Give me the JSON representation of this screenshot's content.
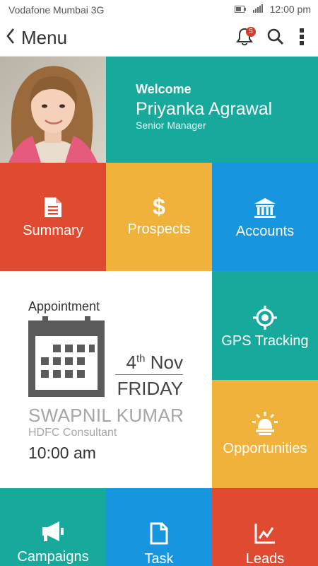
{
  "status_bar": {
    "carrier": "Vodafone Mumbai 3G",
    "time": "12:00 pm",
    "icons": [
      "battery-icon",
      "signal-icon"
    ]
  },
  "app_bar": {
    "back_icon": "chevron-left-icon",
    "title": "Menu",
    "notification_count": "5",
    "actions": [
      "bell-icon",
      "search-icon",
      "more-vertical-icon"
    ]
  },
  "profile": {
    "welcome": "Welcome",
    "name": "Priyanka Agrawal",
    "role": "Senior Manager",
    "photo": "profile-photo"
  },
  "tiles": {
    "summary": {
      "label": "Summary",
      "icon": "document-icon",
      "color": "#e04a30"
    },
    "prospects": {
      "label": "Prospects",
      "icon": "dollar-icon",
      "color": "#f0b23a"
    },
    "accounts": {
      "label": "Accounts",
      "icon": "bank-icon",
      "color": "#1795de"
    },
    "gps": {
      "label": "GPS Tracking",
      "icon": "gps-target-icon",
      "color": "#17a99b"
    },
    "opportunities": {
      "label": "Opportunities",
      "icon": "bell-alert-icon",
      "color": "#f0b23a"
    },
    "campaigns": {
      "label": "Campaigns",
      "icon": "megaphone-icon",
      "color": "#17a99b"
    },
    "task": {
      "label": "Task",
      "icon": "file-icon",
      "color": "#1795de"
    },
    "leads": {
      "label": "Leads",
      "icon": "chart-icon",
      "color": "#e04a30"
    }
  },
  "appointment": {
    "heading": "Appointment",
    "date_day": "4",
    "date_suffix": "th",
    "date_month": "Nov",
    "weekday": "FRIDAY",
    "person": "SWAPNIL KUMAR",
    "person_role": "HDFC Consultant",
    "time": "10:00 am",
    "icon": "calendar-icon"
  },
  "colors": {
    "teal": "#17a99b",
    "red": "#e04a30",
    "yellow": "#f0b23a",
    "blue": "#1795de",
    "badge": "#d63a2a"
  }
}
